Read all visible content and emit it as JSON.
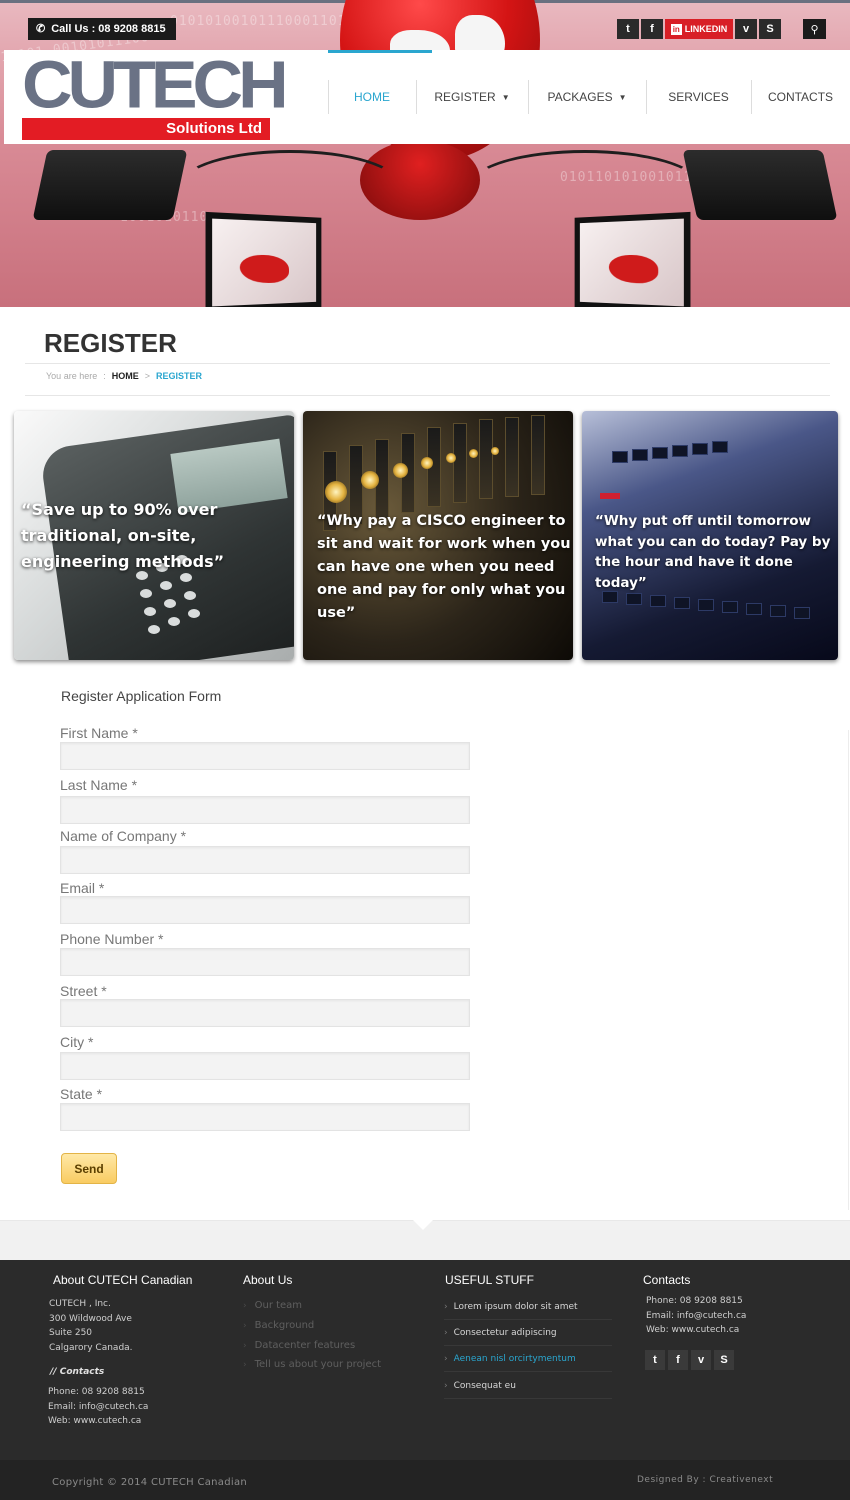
{
  "header": {
    "call_us": "Call Us : 08 9208 8815",
    "social": {
      "twitter": "t",
      "facebook": "f",
      "linkedin": "LINKEDIN",
      "linkedin_badge": "in",
      "vimeo": "v",
      "skype": "S"
    },
    "search_icon": "search-icon",
    "logo_text": "CUTECH",
    "logo_sub": "Solutions Ltd",
    "nav": [
      {
        "label": "HOME",
        "active": true
      },
      {
        "label": "REGISTER",
        "dropdown": true
      },
      {
        "label": "PACKAGES",
        "dropdown": true
      },
      {
        "label": "SERVICES"
      },
      {
        "label": "CONTACTS"
      }
    ]
  },
  "page": {
    "title": "REGISTER",
    "breadcrumb": {
      "prefix": "You are here",
      "separator": ":",
      "home": "HOME",
      "arrow": ">",
      "current": "REGISTER"
    }
  },
  "promos": [
    {
      "quote": "“Save up to 90% over traditional, on-site, engineering methods”"
    },
    {
      "quote": "“Why pay a CISCO engineer to sit and wait for work when you can have one when you need one and pay for only what you use”"
    },
    {
      "quote": "“Why put off until tomorrow what you can do today? Pay by the hour and have it done today”"
    }
  ],
  "form": {
    "title": "Register Application Form",
    "fields": [
      {
        "label": "First Name *",
        "value": ""
      },
      {
        "label": "Last Name *",
        "value": ""
      },
      {
        "label": "Name of Company *",
        "value": ""
      },
      {
        "label": "Email *",
        "value": ""
      },
      {
        "label": "Phone Number *",
        "value": ""
      },
      {
        "label": "Street *",
        "value": ""
      },
      {
        "label": "City *",
        "value": ""
      },
      {
        "label": "State *",
        "value": ""
      }
    ],
    "submit": "Send"
  },
  "footer": {
    "about_company": {
      "heading": "About CUTECH Canadian",
      "address": [
        "CUTECH , Inc.",
        "300 Wildwood Ave",
        "Suite 250",
        "Calgarory Canada."
      ],
      "contacts_heading": "// Contacts",
      "contacts": [
        "Phone: 08 9208 8815",
        "Email: info@cutech.ca",
        "Web: www.cutech.ca"
      ]
    },
    "about_us": {
      "heading": "About Us",
      "links": [
        "Our team",
        "Background",
        "Datacenter features",
        "Tell us about your project"
      ]
    },
    "useful": {
      "heading": "USEFUL STUFF",
      "links": [
        "Lorem ipsum dolor sit amet",
        "Consectetur adipiscing",
        "Aenean nisl orcirtymentum",
        "Consequat eu"
      ],
      "highlight_index": 2
    },
    "contacts": {
      "heading": "Contacts",
      "lines": [
        "Phone: 08 9208 8815",
        "Email: info@cutech.ca",
        "Web: www.cutech.ca"
      ]
    },
    "copyright": "Copyright © 2014 CUTECH Canadian",
    "designed_by": "Designed By :  Creativenext"
  },
  "colors": {
    "accent": "#2aa6cf",
    "brand_red": "#e31c24",
    "logo_grey": "#6a7285",
    "footer_bg": "#2b2b2b",
    "button_yellow": "#f9cc62"
  }
}
